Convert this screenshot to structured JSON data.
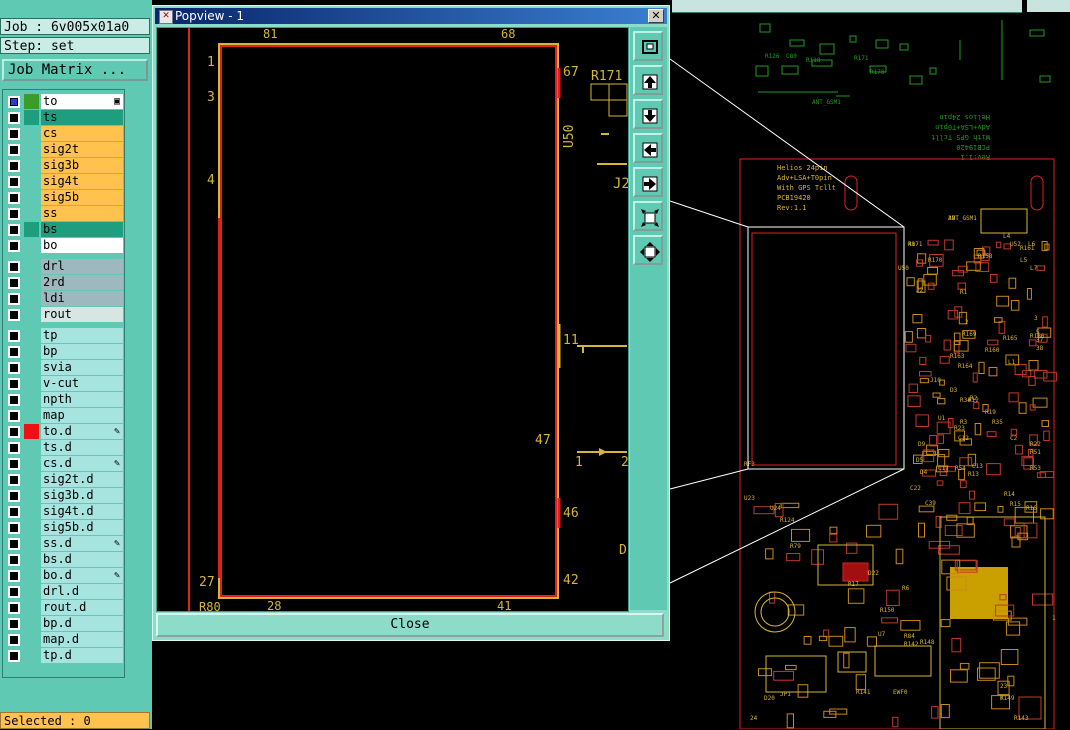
{
  "left": {
    "job_line": "Job : 6v005x01a0",
    "step_line": "Step: set",
    "job_matrix_button": "Job Matrix ...",
    "selected_line": "Selected : 0",
    "layers": [
      {
        "name": "to",
        "color": "#ffffff",
        "swatch": "#3b9c2c",
        "checkbox": "selected",
        "glyph": "▣"
      },
      {
        "name": "ts",
        "color": "#1e9e7e",
        "swatch": "#1e9e7e",
        "checkbox": "off",
        "glyph": ""
      },
      {
        "name": "cs",
        "color": "#ffc24f",
        "swatch": "#5fc9b4",
        "checkbox": "off",
        "glyph": ""
      },
      {
        "name": "sig2t",
        "color": "#ffc24f",
        "swatch": "#5fc9b4",
        "checkbox": "off",
        "glyph": ""
      },
      {
        "name": "sig3b",
        "color": "#ffc24f",
        "swatch": "#5fc9b4",
        "checkbox": "off",
        "glyph": ""
      },
      {
        "name": "sig4t",
        "color": "#ffc24f",
        "swatch": "#5fc9b4",
        "checkbox": "off",
        "glyph": ""
      },
      {
        "name": "sig5b",
        "color": "#ffc24f",
        "swatch": "#5fc9b4",
        "checkbox": "off",
        "glyph": ""
      },
      {
        "name": "ss",
        "color": "#ffc24f",
        "swatch": "#5fc9b4",
        "checkbox": "off",
        "glyph": ""
      },
      {
        "name": "bs",
        "color": "#1e9e7e",
        "swatch": "#1e9e7e",
        "checkbox": "off",
        "glyph": ""
      },
      {
        "name": "bo",
        "color": "#ffffff",
        "swatch": "#5fc9b4",
        "checkbox": "off",
        "glyph": ""
      },
      {
        "name": "drl",
        "color": "#9eb8bf",
        "swatch": "#5fc9b4",
        "checkbox": "off",
        "glyph": ""
      },
      {
        "name": "2rd",
        "color": "#9eb8bf",
        "swatch": "#5fc9b4",
        "checkbox": "off",
        "glyph": ""
      },
      {
        "name": "ldi",
        "color": "#9eb8bf",
        "swatch": "#5fc9b4",
        "checkbox": "off",
        "glyph": ""
      },
      {
        "name": "rout",
        "color": "#d8e6e3",
        "swatch": "#5fc9b4",
        "checkbox": "off",
        "glyph": ""
      },
      {
        "name": "tp",
        "color": "#a7e3df",
        "swatch": "#5fc9b4",
        "checkbox": "off",
        "glyph": ""
      },
      {
        "name": "bp",
        "color": "#a7e3df",
        "swatch": "#5fc9b4",
        "checkbox": "off",
        "glyph": ""
      },
      {
        "name": "svia",
        "color": "#a7e3df",
        "swatch": "#5fc9b4",
        "checkbox": "off",
        "glyph": ""
      },
      {
        "name": "v-cut",
        "color": "#a7e3df",
        "swatch": "#5fc9b4",
        "checkbox": "off",
        "glyph": ""
      },
      {
        "name": "npth",
        "color": "#a7e3df",
        "swatch": "#5fc9b4",
        "checkbox": "off",
        "glyph": ""
      },
      {
        "name": "map",
        "color": "#a7e3df",
        "swatch": "#5fc9b4",
        "checkbox": "off",
        "glyph": ""
      },
      {
        "name": "to.d",
        "color": "#a7e3df",
        "swatch": "#ee1111",
        "checkbox": "off",
        "glyph": "✎"
      },
      {
        "name": "ts.d",
        "color": "#a7e3df",
        "swatch": "#5fc9b4",
        "checkbox": "off",
        "glyph": ""
      },
      {
        "name": "cs.d",
        "color": "#a7e3df",
        "swatch": "#5fc9b4",
        "checkbox": "off",
        "glyph": "✎"
      },
      {
        "name": "sig2t.d",
        "color": "#a7e3df",
        "swatch": "#5fc9b4",
        "checkbox": "off",
        "glyph": ""
      },
      {
        "name": "sig3b.d",
        "color": "#a7e3df",
        "swatch": "#5fc9b4",
        "checkbox": "off",
        "glyph": ""
      },
      {
        "name": "sig4t.d",
        "color": "#a7e3df",
        "swatch": "#5fc9b4",
        "checkbox": "off",
        "glyph": ""
      },
      {
        "name": "sig5b.d",
        "color": "#a7e3df",
        "swatch": "#5fc9b4",
        "checkbox": "off",
        "glyph": ""
      },
      {
        "name": "ss.d",
        "color": "#a7e3df",
        "swatch": "#5fc9b4",
        "checkbox": "off",
        "glyph": "✎"
      },
      {
        "name": "bs.d",
        "color": "#a7e3df",
        "swatch": "#5fc9b4",
        "checkbox": "off",
        "glyph": ""
      },
      {
        "name": "bo.d",
        "color": "#a7e3df",
        "swatch": "#5fc9b4",
        "checkbox": "off",
        "glyph": "✎"
      },
      {
        "name": "drl.d",
        "color": "#a7e3df",
        "swatch": "#5fc9b4",
        "checkbox": "off",
        "glyph": ""
      },
      {
        "name": "rout.d",
        "color": "#a7e3df",
        "swatch": "#5fc9b4",
        "checkbox": "off",
        "glyph": ""
      },
      {
        "name": "bp.d",
        "color": "#a7e3df",
        "swatch": "#5fc9b4",
        "checkbox": "off",
        "glyph": ""
      },
      {
        "name": "map.d",
        "color": "#a7e3df",
        "swatch": "#5fc9b4",
        "checkbox": "off",
        "glyph": ""
      },
      {
        "name": "tp.d",
        "color": "#a7e3df",
        "swatch": "#5fc9b4",
        "checkbox": "off",
        "glyph": ""
      }
    ]
  },
  "popup": {
    "title": "Popview - 1",
    "close_x": "✕",
    "close_button": "Close",
    "tools": [
      {
        "icon": "zoom-window-icon"
      },
      {
        "icon": "pan-up-icon"
      },
      {
        "icon": "pan-down-icon"
      },
      {
        "icon": "pan-left-icon"
      },
      {
        "icon": "pan-right-icon"
      },
      {
        "icon": "zoom-out-icon"
      },
      {
        "icon": "zoom-fit-icon"
      }
    ],
    "zoom_labels": {
      "tl_num": "81",
      "tr_num": "68",
      "r67": "67",
      "r171": "R171",
      "u50": "U50",
      "j2": "J2",
      "l1": "1",
      "l3": "3",
      "l4": "4",
      "l27": "27",
      "r11": "11",
      "r47": "47",
      "r46": "46",
      "r42": "42",
      "b28": "28",
      "b41": "41",
      "r80": "R80",
      "one": "1",
      "two": "2",
      "d": "D"
    }
  },
  "board": {
    "title_lines": [
      "Helios 24pin",
      "Adv+LSA+T0pin",
      "With GPS Tcllt",
      "PCB19420",
      "Rev:1.1"
    ],
    "mirror_lines": [
      "Helios 24pin",
      "Adv+LSA+T0pin",
      "With GPS Tcllt",
      "PCB19420",
      "Rev:1.1"
    ],
    "labels": [
      "ANT_GSM1",
      "R171",
      "R170",
      "U50",
      "J2",
      "R158",
      "L4",
      "U52",
      "L5",
      "L6",
      "R1",
      "R161",
      "L7",
      "R166",
      "R165",
      "R169",
      "R160",
      "L1",
      "C2",
      "R163",
      "R164",
      "J10",
      "D3",
      "R34",
      "R12",
      "R19",
      "R2",
      "R35",
      "U1",
      "R3",
      "C12",
      "R23",
      "C13",
      "R22",
      "R51",
      "R53",
      "C17",
      "C22",
      "D9",
      "D5",
      "D4",
      "R13",
      "R14",
      "R15",
      "R16",
      "R54",
      "C39",
      "RF3",
      "U23",
      "U24",
      "R79",
      "D22",
      "R17",
      "R6",
      "U7",
      "R84",
      "R142",
      "R148",
      "R141",
      "EWF0",
      "JP1",
      "D20",
      "R143",
      "R149",
      "R150",
      "R124",
      "24",
      "23",
      "T",
      "1",
      "2",
      "3",
      "5",
      "37",
      "38",
      "39",
      "40"
    ],
    "colors": {
      "board_edge": "#e02020",
      "silk": "#d6b636",
      "copper": "#c98a1a",
      "pad": "#c9a000",
      "trace": "#cc8a38"
    }
  }
}
